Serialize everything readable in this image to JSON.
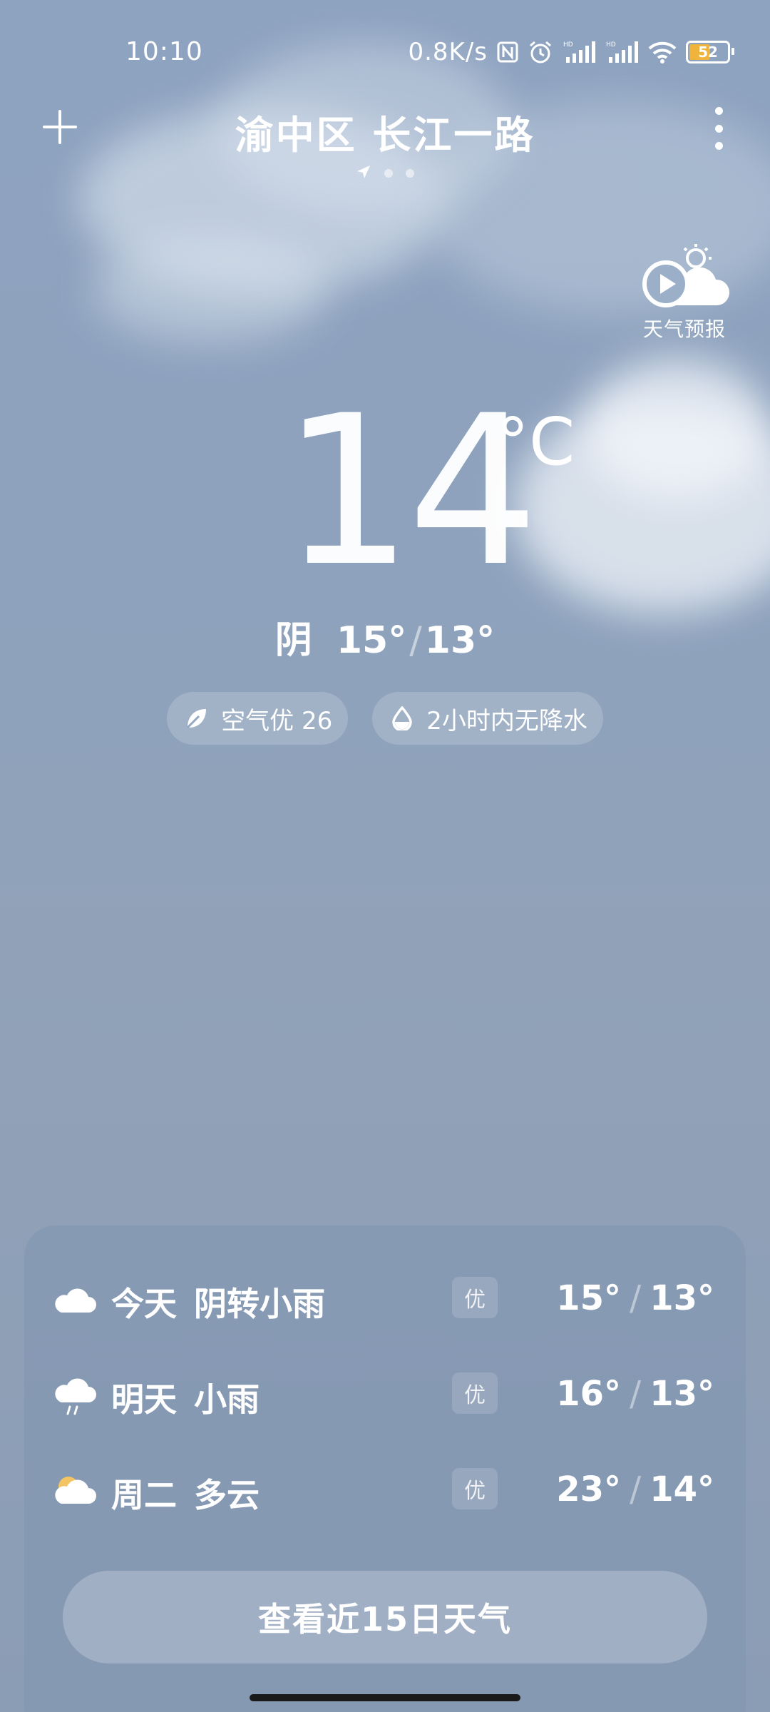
{
  "status_bar": {
    "time": "10:10",
    "net_speed": "0.8K/s",
    "battery_percent": "52",
    "battery_level": 0.52,
    "icons": [
      "nfc-icon",
      "alarm-icon",
      "signal-hd-icon",
      "signal-hd-icon",
      "wifi-icon",
      "battery-icon"
    ]
  },
  "header": {
    "location": "渝中区 长江一路",
    "add_icon": "plus-icon",
    "more_icon": "more-vertical-icon",
    "page_count": 3,
    "active_page_icon": "location-arrow-icon"
  },
  "forecast_video": {
    "label": "天气预报",
    "icon": "play-sun-cloud-icon"
  },
  "current": {
    "temperature": "14",
    "unit": "°C",
    "condition": "阴",
    "high": "15°",
    "low": "13°"
  },
  "chips": {
    "air": {
      "icon": "leaf-icon",
      "text": "空气优 26"
    },
    "rain": {
      "icon": "drop-icon",
      "text": "2小时内无降水"
    }
  },
  "forecast": [
    {
      "day": "今天",
      "condition": "阴转小雨",
      "aqi": "优",
      "high": "15°",
      "low": "13°",
      "icon": "cloudy-icon"
    },
    {
      "day": "明天",
      "condition": "小雨",
      "aqi": "优",
      "high": "16°",
      "low": "13°",
      "icon": "light-rain-icon"
    },
    {
      "day": "周二",
      "condition": "多云",
      "aqi": "优",
      "high": "23°",
      "low": "14°",
      "icon": "partly-cloudy-icon"
    }
  ],
  "view_15_days": "查看近15日天气",
  "colors": {
    "sky": "#8ea3c0",
    "card": "#8296b2",
    "sun": "#f3c463",
    "battery": "#f0b43c"
  }
}
